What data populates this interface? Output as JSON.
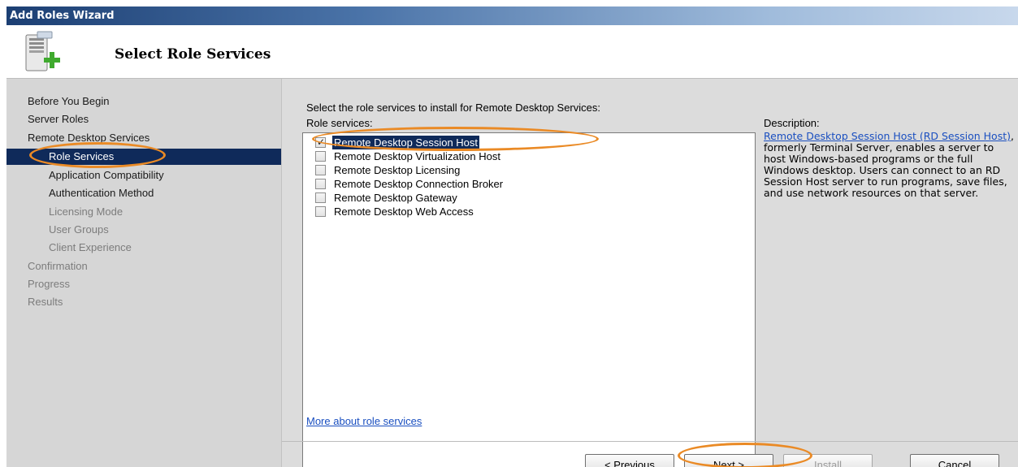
{
  "window": {
    "title": "Add Roles Wizard"
  },
  "header": {
    "title": "Select Role Services",
    "icon": "server-add-icon"
  },
  "nav": {
    "items": [
      {
        "label": "Before You Begin",
        "state": "normal"
      },
      {
        "label": "Server Roles",
        "state": "normal"
      },
      {
        "label": "Remote Desktop Services",
        "state": "normal"
      },
      {
        "label": "Role Services",
        "state": "active"
      },
      {
        "label": "Application Compatibility",
        "state": "normal"
      },
      {
        "label": "Authentication Method",
        "state": "normal"
      },
      {
        "label": "Licensing Mode",
        "state": "disabled"
      },
      {
        "label": "User Groups",
        "state": "disabled"
      },
      {
        "label": "Client Experience",
        "state": "disabled"
      },
      {
        "label": "Confirmation",
        "state": "disabled"
      },
      {
        "label": "Progress",
        "state": "disabled"
      },
      {
        "label": "Results",
        "state": "disabled"
      }
    ]
  },
  "main": {
    "instruction": "Select the role services to install for Remote Desktop Services:",
    "role_services_label": "Role services:",
    "role_services": [
      {
        "label": "Remote Desktop Session Host",
        "checked": true
      },
      {
        "label": "Remote Desktop Virtualization Host",
        "checked": false
      },
      {
        "label": "Remote Desktop Licensing",
        "checked": false
      },
      {
        "label": "Remote Desktop Connection Broker",
        "checked": false
      },
      {
        "label": "Remote Desktop Gateway",
        "checked": false
      },
      {
        "label": "Remote Desktop Web Access",
        "checked": false
      }
    ],
    "description_title": "Description:",
    "description_link": "Remote Desktop Session Host (RD Session Host)",
    "description_text": ", formerly Terminal Server, enables a server to host Windows-based programs or the full Windows desktop. Users can connect to an RD Session Host server to run programs, save files, and use network resources on that server.",
    "more_link": "More about role services"
  },
  "buttons": {
    "previous": "< Previous",
    "next": "Next >",
    "install": "Install",
    "cancel": "Cancel"
  },
  "colors": {
    "callout": "#ea8a25",
    "selection": "#0f2a5a",
    "link": "#1a4fc0"
  }
}
